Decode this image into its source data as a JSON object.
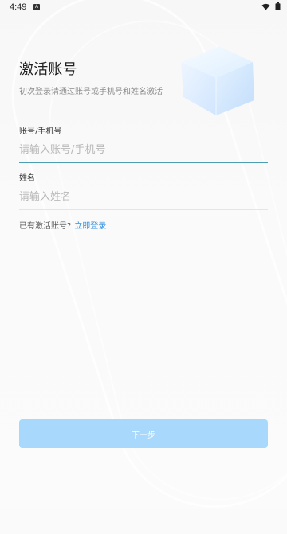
{
  "status_bar": {
    "time": "4:49",
    "notification_label": "A"
  },
  "header": {
    "title": "激活账号",
    "subtitle": "初次登录请通过账号或手机号和姓名激活"
  },
  "form": {
    "account": {
      "label": "账号/手机号",
      "placeholder": "请输入账号/手机号",
      "value": ""
    },
    "name": {
      "label": "姓名",
      "placeholder": "请输入姓名",
      "value": ""
    }
  },
  "hint": {
    "text": "已有激活账号?",
    "link_label": "立即登录"
  },
  "actions": {
    "next_label": "下一步",
    "enabled": false
  },
  "colors": {
    "accent": "#2f8fe0",
    "input_active_underline": "#4aa0b2",
    "button_disabled": "#a8d8fb"
  },
  "icons": {
    "wifi": "wifi-icon",
    "battery": "battery-icon"
  }
}
